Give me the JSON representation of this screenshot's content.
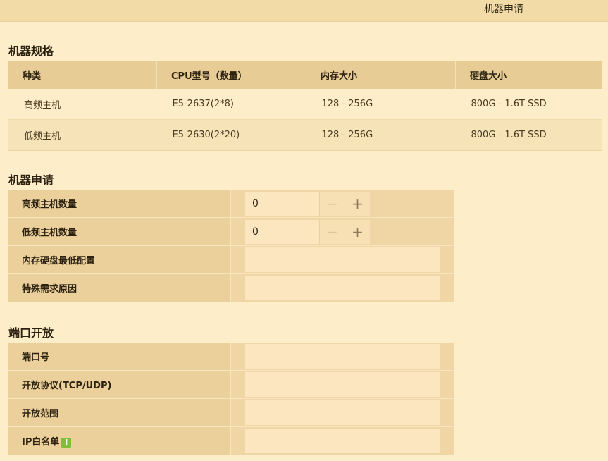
{
  "header": {
    "tab_label": "机器申请"
  },
  "spec": {
    "title": "机器规格",
    "columns": [
      "种类",
      "CPU型号（数量）",
      "内存大小",
      "硬盘大小"
    ],
    "rows": [
      [
        "高频主机",
        "E5-2637(2*8)",
        "128 - 256G",
        "800G - 1.6T SSD"
      ],
      [
        "低频主机",
        "E5-2630(2*20)",
        "128 - 256G",
        "800G - 1.6T SSD"
      ]
    ]
  },
  "apply": {
    "title": "机器申请",
    "high_label": "高频主机数量",
    "high_value": "0",
    "low_label": "低频主机数量",
    "low_value": "0",
    "min_config_label": "内存硬盘最低配置",
    "reason_label": "特殊需求原因",
    "minus_symbol": "−",
    "plus_symbol": "+"
  },
  "ports": {
    "title": "端口开放",
    "port_label": "端口号",
    "protocol_label": "开放协议(TCP/UDP)",
    "range_label": "开放范围",
    "whitelist_label": "IP白名单",
    "warn_symbol": "!"
  },
  "colors": {
    "background": "#fdedc8",
    "header_bg": "#e8cc96",
    "label_bg": "#ecd09b",
    "warn_icon": "#7fbf3b"
  }
}
